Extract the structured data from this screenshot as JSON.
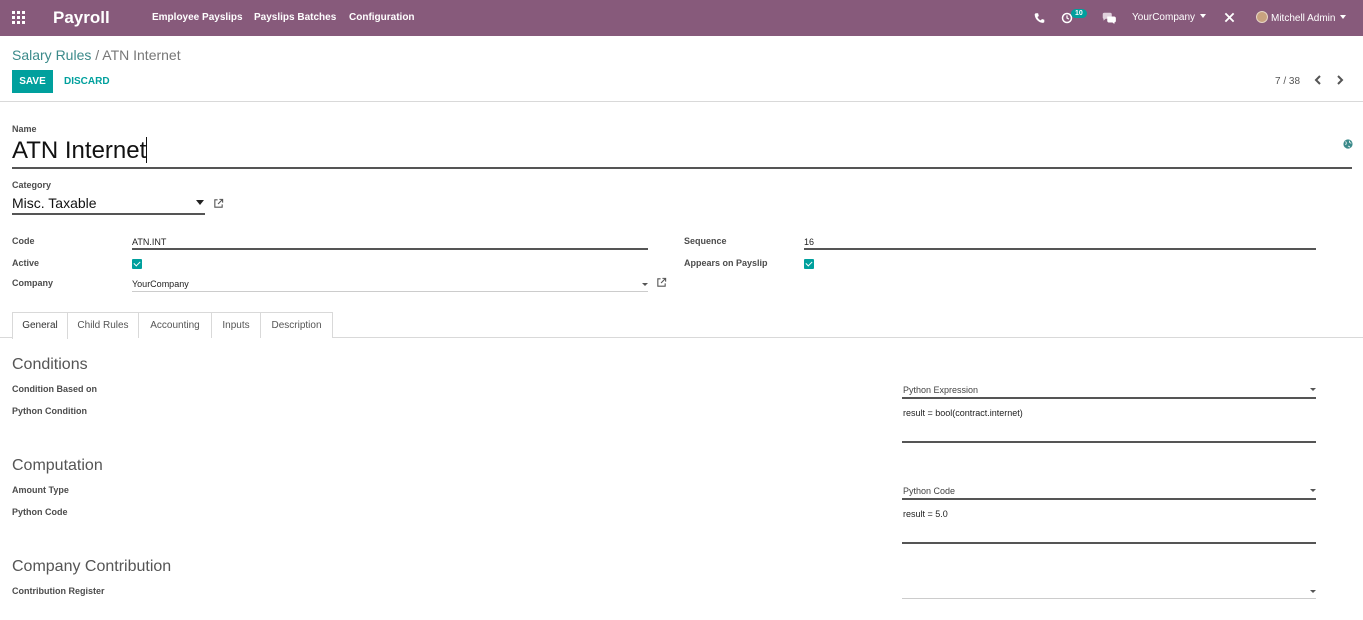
{
  "topbar": {
    "brand": "Payroll",
    "menu": [
      "Employee Payslips",
      "Payslips Batches",
      "Configuration"
    ],
    "activity_count": "10",
    "company": "YourCompany",
    "user": "Mitchell Admin"
  },
  "breadcrumb": {
    "parent": "Salary Rules",
    "separator": "/",
    "current": "ATN Internet"
  },
  "buttons": {
    "save": "SAVE",
    "discard": "DISCARD"
  },
  "pager": {
    "text": "7 / 38"
  },
  "form": {
    "name_label": "Name",
    "name_value": "ATN Internet",
    "category_label": "Category",
    "category_value": "Misc. Taxable",
    "code_label": "Code",
    "code_value": "ATN.INT",
    "active_label": "Active",
    "active_checked": true,
    "company_label": "Company",
    "company_value": "YourCompany",
    "sequence_label": "Sequence",
    "sequence_value": "16",
    "appears_label": "Appears on Payslip",
    "appears_checked": true
  },
  "tabs": [
    "General",
    "Child Rules",
    "Accounting",
    "Inputs",
    "Description"
  ],
  "active_tab": "General",
  "conditions": {
    "title": "Conditions",
    "based_on_label": "Condition Based on",
    "based_on_value": "Python Expression",
    "python_condition_label": "Python Condition",
    "python_condition_value": "result = bool(contract.internet)"
  },
  "computation": {
    "title": "Computation",
    "amount_type_label": "Amount Type",
    "amount_type_value": "Python Code",
    "python_code_label": "Python Code",
    "python_code_value": "result = 5.0"
  },
  "contribution": {
    "title": "Company Contribution",
    "register_label": "Contribution Register",
    "register_value": ""
  },
  "colors": {
    "primary": "#875a7b",
    "accent": "#00a09d"
  }
}
